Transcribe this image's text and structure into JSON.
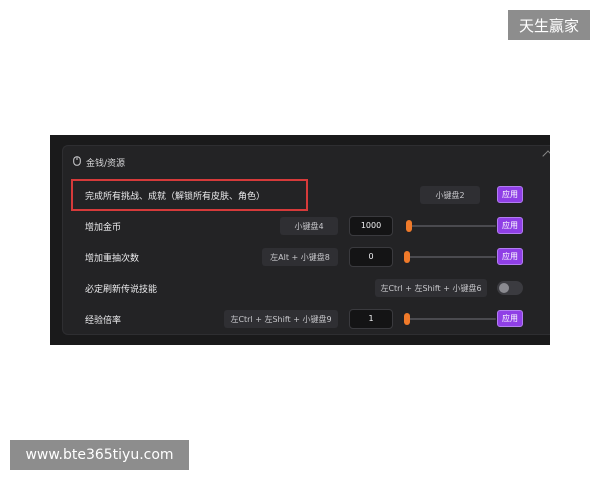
{
  "watermarks": {
    "top": "天生赢家",
    "bottom": "www.bte365tiyu.com"
  },
  "panel": {
    "title": "金钱/资源",
    "header_icon": "mouse-icon",
    "collapse_icon": "chevron-up-icon"
  },
  "rows": [
    {
      "label": "完成所有挑战、成就（解锁所有皮肤、角色）",
      "hotkey": "小键盘2",
      "button": "应用"
    },
    {
      "label": "增加金币",
      "hotkey": "小键盘4",
      "value": "1000",
      "slider_fraction": 0.02,
      "button": "应用"
    },
    {
      "label": "增加重抽次数",
      "hotkey": "左Alt + 小键盘8",
      "value": "0",
      "slider_fraction": 0.0,
      "button": "应用"
    },
    {
      "label": "必定刷新传说技能",
      "hotkey": "左Ctrl + 左Shift + 小键盘6",
      "toggle_on": false
    },
    {
      "label": "经验倍率",
      "hotkey": "左Ctrl + 左Shift + 小键盘9",
      "value": "1",
      "slider_fraction": 0.0,
      "button": "应用"
    }
  ],
  "colors": {
    "accent_purple": "#8f3fe6",
    "slider_orange": "#f07a2a",
    "highlight_red": "#d63a3a"
  }
}
